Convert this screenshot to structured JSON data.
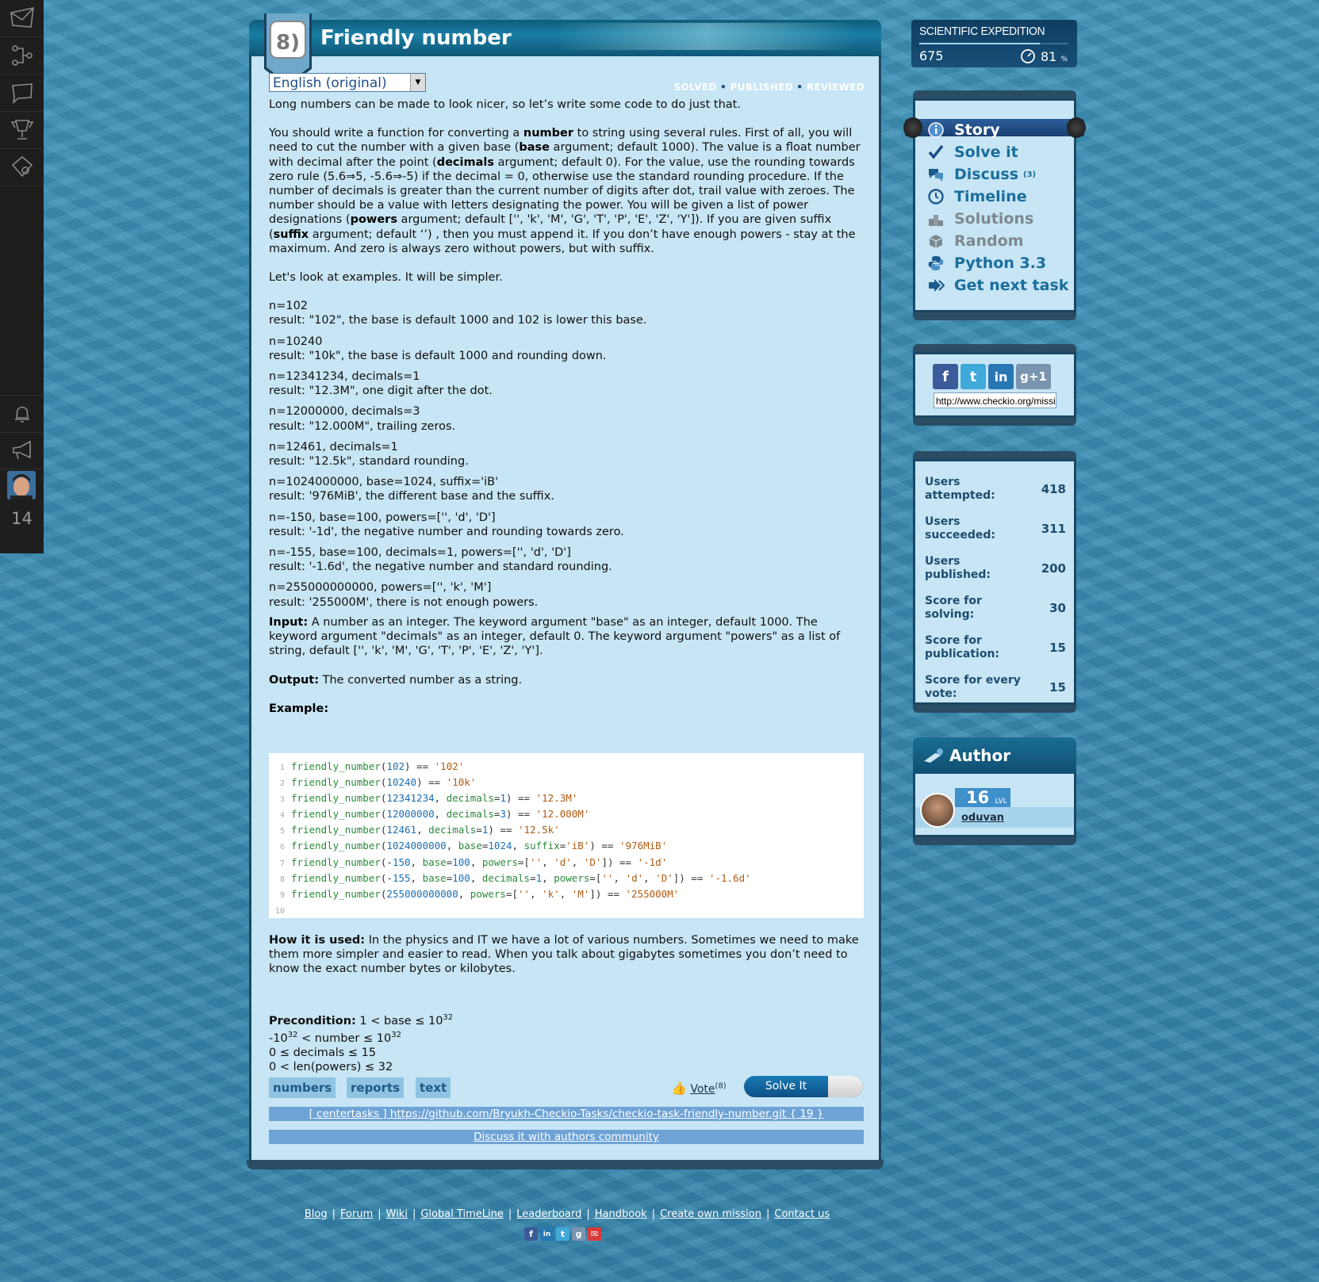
{
  "leftbar": {
    "level": "14"
  },
  "task": {
    "number": "8)",
    "title": "Friendly number",
    "language": "English (original)",
    "status": [
      "SOLVED",
      "PUBLISHED",
      "REVIEWED"
    ],
    "intro": "Long numbers can be made to look nicer, so let’s write some code to do just that.",
    "p2": {
      "a": "You should write a function for converting a ",
      "b": "number",
      "c": " to string using several rules. First of all, you will need to cut the number with a given base (",
      "d": "base",
      "e": " argument; default 1000). The value is a float number with decimal after the point (",
      "f": "decimals",
      "g": " argument; default 0). For the value, use the rounding towards zero rule (5.6⇒5, -5.6⇒-5) if the decimal = 0, otherwise use the standard rounding procedure. If the number of decimals is greater than the current number of digits after dot, trail value with zeroes. The number should be a value with letters designating the power. You will be given a list of power designations (",
      "h": "powers",
      "i": " argument; default ['', 'k', 'M', 'G', 'T', 'P', 'E', 'Z', 'Y']). If you are given suffix (",
      "j": "suffix",
      "k": " argument; default ‘’) , then you must append it. If you don’t have enough powers - stay at the maximum. And zero is always zero without powers, but with suffix."
    },
    "examples_intro": "Let's look at examples. It will be simpler.",
    "examples": [
      [
        "n=102",
        "result: \"102\", the base is default 1000 and 102 is lower this base."
      ],
      [
        "n=10240",
        "result: \"10k\", the base is default 1000 and rounding down."
      ],
      [
        "n=12341234, decimals=1",
        "result: \"12.3M\", one digit after the dot."
      ],
      [
        "n=12000000, decimals=3",
        "result: \"12.000M\", trailing zeros."
      ],
      [
        "n=12461, decimals=1",
        "result: \"12.5k\", standard rounding."
      ],
      [
        "n=1024000000, base=1024, suffix='iB'",
        "result: '976MiB', the different base and the suffix."
      ],
      [
        "n=-150, base=100, powers=['', 'd', 'D']",
        "result: '-1d', the negative number and rounding towards zero."
      ],
      [
        "n=-155, base=100, decimals=1, powers=['', 'd', 'D']",
        "result: '-1.6d', the negative number and standard rounding."
      ],
      [
        "n=255000000000, powers=['', 'k', 'M']",
        "result: '255000M', there is not enough powers."
      ]
    ],
    "input_label": "Input:",
    "input_text": " A number as an integer. The keyword argument \"base\" as an integer, default 1000. The keyword argument \"decimals\" as an integer, default 0. The keyword argument \"powers\" as a list of string, default ['', 'k', 'M', 'G', 'T', 'P', 'E', 'Z', 'Y'].",
    "output_label": "Output:",
    "output_text": " The converted number as a string.",
    "example_label": "Example:",
    "usage_label": "How it is used:",
    "usage_text": " In the physics and IT we have a lot of various numbers. Sometimes we need to make them more simpler and easier to read. When you talk about gigabytes sometimes you don’t need to know the exact number bytes or kilobytes.",
    "precondition_label": "Precondition:",
    "tags": [
      "numbers",
      "reports",
      "text"
    ],
    "vote_label": "Vote",
    "vote_count": "(8)",
    "solve_label": "Solve It",
    "repo_link": "[ centertasks ] https://github.com/Bryukh-Checkio-Tasks/checkio-task-friendly-number.git { 19 }",
    "discuss_link": "Discuss it with authors community"
  },
  "expedition": {
    "title": "SCIENTIFIC EXPEDITION",
    "count": "675",
    "percent": "81",
    "percent_unit": "%",
    "progress": 0.81
  },
  "menu": {
    "items": [
      {
        "label": "Story",
        "badge": ""
      },
      {
        "label": "Solve it",
        "badge": ""
      },
      {
        "label": "Discuss",
        "badge": "(3)"
      },
      {
        "label": "Timeline",
        "badge": ""
      },
      {
        "label": "Solutions",
        "badge": ""
      },
      {
        "label": "Random",
        "badge": ""
      },
      {
        "label": "Python 3.3",
        "badge": ""
      },
      {
        "label": "Get next task",
        "badge": ""
      }
    ]
  },
  "share": {
    "url": "http://www.checkio.org/mission/friendly-number/"
  },
  "stats": [
    {
      "label": "Users attempted:",
      "value": "418"
    },
    {
      "label": "Users succeeded:",
      "value": "311"
    },
    {
      "label": "Users published:",
      "value": "200"
    },
    {
      "label": "Score for solving:",
      "value": "30"
    },
    {
      "label": "Score for publication:",
      "value": "15"
    },
    {
      "label": "Score for every vote:",
      "value": "15"
    }
  ],
  "author": {
    "heading": "Author",
    "level": "16",
    "level_unit": "LVL",
    "name": "oduvan"
  },
  "footer": {
    "links": [
      "Blog",
      "Forum",
      "Wiki",
      "Global TimeLine",
      "Leaderboard",
      "Handbook",
      "Create own mission",
      "Contact us"
    ]
  }
}
